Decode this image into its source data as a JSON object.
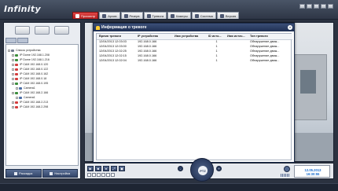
{
  "app": {
    "logo": "Infinity"
  },
  "header": {
    "tabs": [
      {
        "label": "Просмотр",
        "active": true,
        "icon": "monitor-icon"
      },
      {
        "label": "Архив",
        "active": false,
        "icon": "archive-icon"
      },
      {
        "label": "Резерв",
        "active": false,
        "icon": "backup-icon"
      },
      {
        "label": "Тревога",
        "active": false,
        "icon": "alarm-icon"
      },
      {
        "label": "Камеры",
        "active": false,
        "icon": "camera-icon"
      },
      {
        "label": "Система",
        "active": false,
        "icon": "system-icon"
      },
      {
        "label": "Версия",
        "active": false,
        "icon": "info-icon"
      }
    ],
    "window_buttons": [
      "lock-icon",
      "settings-icon",
      "minimize-icon",
      "maximize-icon",
      "close-icon"
    ]
  },
  "sidebar": {
    "tree": [
      {
        "label": "Список устройства",
        "level": 0,
        "color": "#6e7a8c"
      },
      {
        "label": "IP Dome 192.168.1.208",
        "level": 1,
        "color": "#3b8d3b"
      },
      {
        "label": "IP Dome 192.168.1.216",
        "level": 1,
        "color": "#3b8d3b"
      },
      {
        "label": "IP CAM 192.168.0.120",
        "level": 1,
        "color": "#d33c3c"
      },
      {
        "label": "IP CAM 192.168.0.122",
        "level": 1,
        "color": "#d33c3c"
      },
      {
        "label": "IP CAM 192.168.0.162",
        "level": 1,
        "color": "#d33c3c"
      },
      {
        "label": "IP CAM 192.168.0.18",
        "level": 1,
        "color": "#d33c3c"
      },
      {
        "label": "IP CAM 192.168.0.195",
        "level": 1,
        "color": "#3b8d3b"
      },
      {
        "label": "Camera1",
        "level": 2,
        "color": "#4d6fa8"
      },
      {
        "label": "IP CAM 192.168.2.166",
        "level": 1,
        "color": "#3b8d3b"
      },
      {
        "label": "Camera1",
        "level": 2,
        "color": "#4d6fa8"
      },
      {
        "label": "IP CAM 192.168.2.213",
        "level": 1,
        "color": "#d33c3c"
      },
      {
        "label": "IP CAM 192.168.2.298",
        "level": 1,
        "color": "#d33c3c"
      }
    ],
    "footer": {
      "layout_label": "Раскадка",
      "settings_label": "Настройка"
    }
  },
  "alarm_dialog": {
    "title": "Информация о тревоге",
    "columns": [
      "Время тревоги",
      "IP устройства",
      "Имя устройства",
      "ID исто...",
      "Имя источ...",
      "Тип тревоги"
    ],
    "rows": [
      [
        "12/04/2013 12:03:03",
        "192.168.0.166",
        "",
        "1",
        "",
        "Обнаружение движ..."
      ],
      [
        "12/04/2013 12:03:00",
        "192.168.0.166",
        "",
        "1",
        "",
        "Обнаружение движ..."
      ],
      [
        "12/04/2013 12:02:25",
        "192.168.0.166",
        "",
        "1",
        "",
        "Обнаружение движ..."
      ],
      [
        "12/04/2013 12:02:15",
        "192.168.0.166",
        "",
        "1",
        "",
        "Обнаружение движ..."
      ],
      [
        "12/04/2013 12:02:04",
        "192.168.0.166",
        "",
        "1",
        "",
        "Обнаружение движ..."
      ]
    ]
  },
  "controls": {
    "ptz_label": "PTZ",
    "date": "12.05.2013",
    "time": "16:30:55"
  },
  "colors": {
    "accent_active_tab": "#c62828",
    "clock_text": "#1c6fd1",
    "panel_dark": "#2b3240"
  }
}
